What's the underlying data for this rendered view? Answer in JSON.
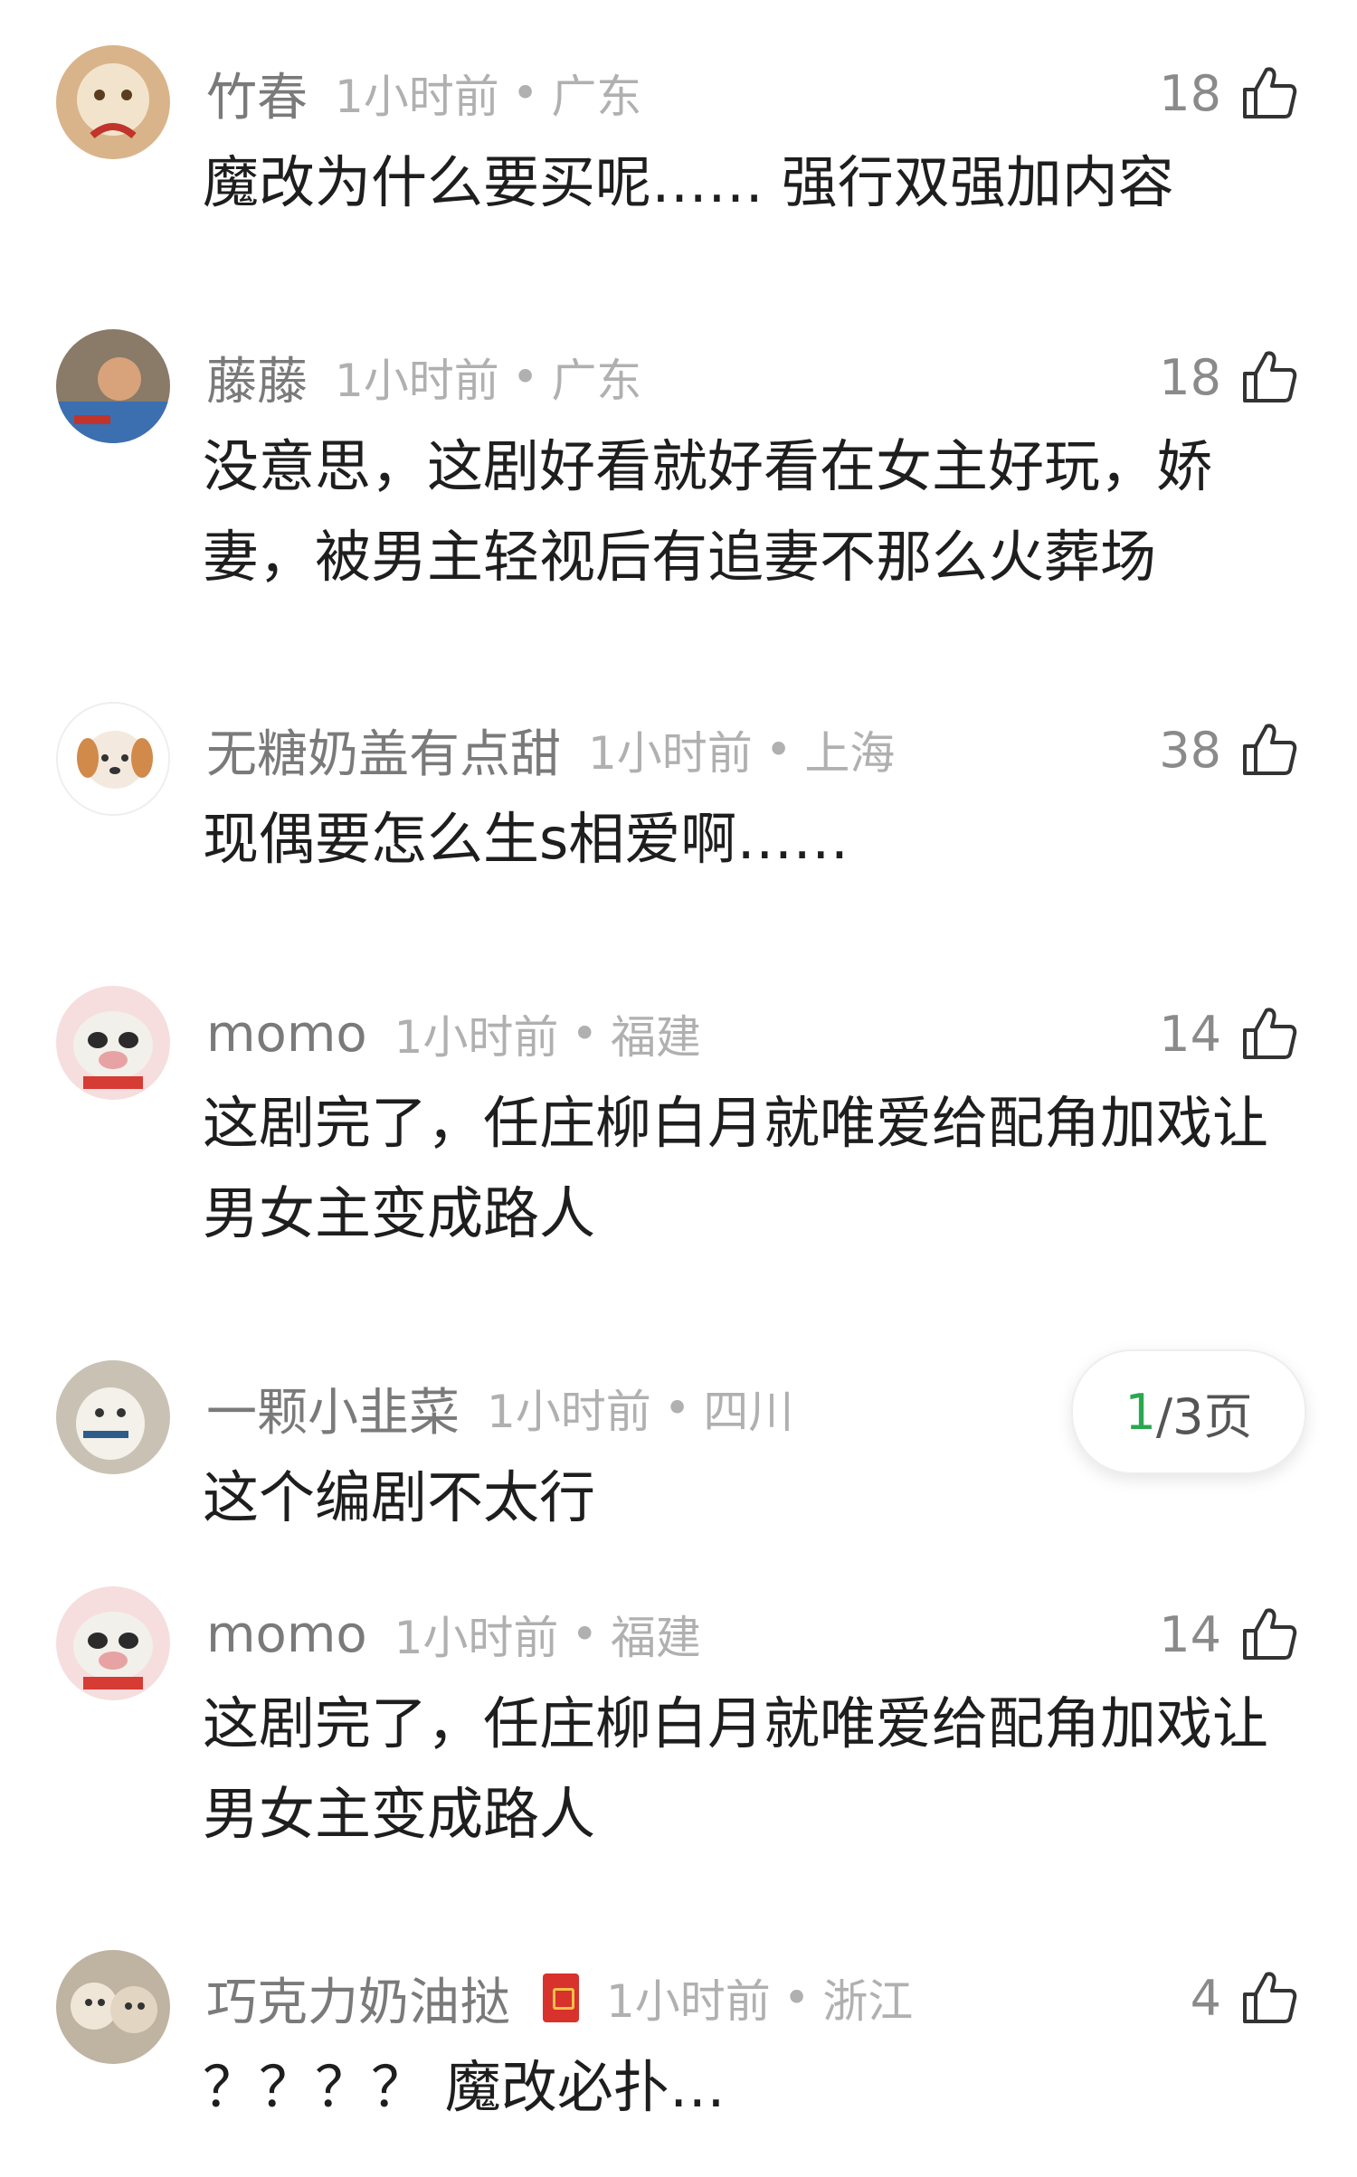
{
  "comments": [
    {
      "user": "竹春",
      "time": "1小时前",
      "sep": "•",
      "location": "广东",
      "likes": "18",
      "text": "魔改为什么要买呢…… 强行双强加内容",
      "avatar_icon": "cat-avatar-icon",
      "has_badge": false
    },
    {
      "user": "藤藤",
      "time": "1小时前",
      "sep": "•",
      "location": "广东",
      "likes": "18",
      "text": "没意思，这剧好看就好看在女主好玩，娇妻，被男主轻视后有追妻不那么火葬场",
      "avatar_icon": "photo-avatar-icon",
      "has_badge": false
    },
    {
      "user": "无糖奶盖有点甜",
      "time": "1小时前",
      "sep": "•",
      "location": "上海",
      "likes": "38",
      "text": "现偶要怎么生s相爱啊……",
      "avatar_icon": "puppy-avatar-icon",
      "has_badge": false
    },
    {
      "user": "momo",
      "time": "1小时前",
      "sep": "•",
      "location": "福建",
      "likes": "14",
      "text": "这剧完了，任庄柳白月就唯爱给配角加戏让男女主变成路人",
      "avatar_icon": "pig-avatar-icon",
      "has_badge": false
    },
    {
      "user": "一颗小韭菜",
      "time": "1小时前",
      "sep": "•",
      "location": "四川",
      "likes": "",
      "text": "这个编剧不太行",
      "avatar_icon": "plush-avatar-icon",
      "has_badge": false
    },
    {
      "user": "momo",
      "time": "1小时前",
      "sep": "•",
      "location": "福建",
      "likes": "14",
      "text": "这剧完了，任庄柳白月就唯爱给配角加戏让男女主变成路人",
      "avatar_icon": "pig-avatar-icon",
      "has_badge": false
    },
    {
      "user": "巧克力奶油挞",
      "time": "1小时前",
      "sep": "•",
      "location": "浙江",
      "likes": "4",
      "text": "？？？？ 魔改必扑…",
      "avatar_icon": "plush-group-avatar-icon",
      "has_badge": true
    }
  ],
  "pager": {
    "current": "1",
    "rest": "/3页"
  },
  "icons": {
    "like": "thumbs-up-icon",
    "badge": "red-badge-icon"
  },
  "colors": {
    "username": "#7a7a7a",
    "meta": "#b0b0b0",
    "text": "#1e1e1e",
    "pager_current": "#2aa84f"
  }
}
